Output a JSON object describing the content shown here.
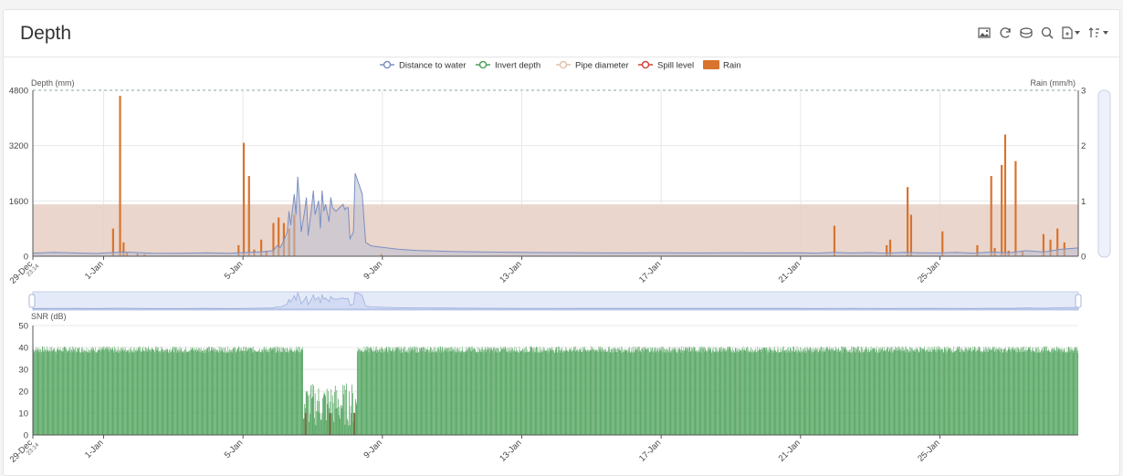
{
  "header": {
    "title": "Depth"
  },
  "toolbar": {
    "icons": [
      "image-icon",
      "refresh-icon",
      "database-icon",
      "search-icon",
      "export-icon",
      "sort-icon"
    ]
  },
  "legend": {
    "items": [
      {
        "label": "Distance to water",
        "color": "#7b8fc3",
        "kind": "line"
      },
      {
        "label": "Invert depth",
        "color": "#4ea05e",
        "kind": "line"
      },
      {
        "label": "Pipe diameter",
        "color": "#e0c2ad",
        "kind": "line"
      },
      {
        "label": "Spill level",
        "color": "#d1453b",
        "kind": "line"
      },
      {
        "label": "Rain",
        "color": "#d8742e",
        "kind": "bar"
      }
    ]
  },
  "colors": {
    "grid": "#e8e8e8",
    "axis": "#555555",
    "snr": "#5aa866",
    "snrDark": "#7a6a3a",
    "band": "#e8d2c6",
    "level": "#7b8fc3"
  },
  "chart_data": [
    {
      "type": "line",
      "ylabel": "Depth (mm)",
      "y2label": "Rain (mm/h)",
      "ylim": [
        0,
        4800
      ],
      "y2lim": [
        0,
        3
      ],
      "yticks": [
        "0",
        "1600",
        "3200",
        "4800"
      ],
      "y2ticks": [
        "0",
        "1",
        "2",
        "3"
      ],
      "xlim": [
        0,
        30
      ],
      "xticks": [
        {
          "label": "29-Dec",
          "sub": "23:14",
          "x": 0
        },
        {
          "label": "1-Jan",
          "x": 2.03
        },
        {
          "label": "5-Jan",
          "x": 6.03
        },
        {
          "label": "9-Jan",
          "x": 10.03
        },
        {
          "label": "13-Jan",
          "x": 14.03
        },
        {
          "label": "17-Jan",
          "x": 18.03
        },
        {
          "label": "21-Jan",
          "x": 22.03
        },
        {
          "label": "25-Jan",
          "x": 26.03
        }
      ],
      "pipe_diameter_band": 1500,
      "series": [
        {
          "name": "Distance to water",
          "points": [
            [
              0,
              90
            ],
            [
              0.6,
              110
            ],
            [
              1.2,
              95
            ],
            [
              1.8,
              80
            ],
            [
              2.6,
              120
            ],
            [
              3.4,
              90
            ],
            [
              4.2,
              85
            ],
            [
              5.0,
              100
            ],
            [
              5.6,
              85
            ],
            [
              6.2,
              110
            ],
            [
              6.6,
              130
            ],
            [
              6.9,
              160
            ],
            [
              7.0,
              300
            ],
            [
              7.1,
              250
            ],
            [
              7.2,
              450
            ],
            [
              7.3,
              700
            ],
            [
              7.35,
              1300
            ],
            [
              7.4,
              900
            ],
            [
              7.5,
              1800
            ],
            [
              7.55,
              1200
            ],
            [
              7.6,
              2300
            ],
            [
              7.65,
              1600
            ],
            [
              7.7,
              700
            ],
            [
              7.8,
              1300
            ],
            [
              7.85,
              1700
            ],
            [
              7.9,
              600
            ],
            [
              8.0,
              1400
            ],
            [
              8.05,
              1900
            ],
            [
              8.1,
              1200
            ],
            [
              8.2,
              1600
            ],
            [
              8.25,
              800
            ],
            [
              8.3,
              1900
            ],
            [
              8.35,
              1300
            ],
            [
              8.4,
              1500
            ],
            [
              8.5,
              1000
            ],
            [
              8.55,
              1700
            ],
            [
              8.6,
              1400
            ],
            [
              8.7,
              1300
            ],
            [
              8.8,
              1400
            ],
            [
              8.9,
              1500
            ],
            [
              8.95,
              1350
            ],
            [
              9.0,
              1400
            ],
            [
              9.05,
              1400
            ],
            [
              9.1,
              500
            ],
            [
              9.2,
              700
            ],
            [
              9.25,
              2400
            ],
            [
              9.35,
              2100
            ],
            [
              9.45,
              1800
            ],
            [
              9.55,
              400
            ],
            [
              9.7,
              300
            ],
            [
              10.0,
              260
            ],
            [
              10.5,
              200
            ],
            [
              11,
              170
            ],
            [
              12,
              140
            ],
            [
              13,
              120
            ],
            [
              14,
              110
            ],
            [
              15,
              105
            ],
            [
              16,
              100
            ],
            [
              17,
              95
            ],
            [
              18,
              100
            ],
            [
              19,
              95
            ],
            [
              20,
              100
            ],
            [
              21,
              95
            ],
            [
              22,
              100
            ],
            [
              22.5,
              90
            ],
            [
              23,
              110
            ],
            [
              23.5,
              95
            ],
            [
              24,
              105
            ],
            [
              24.5,
              90
            ],
            [
              25,
              110
            ],
            [
              25.5,
              100
            ],
            [
              26,
              95
            ],
            [
              26.5,
              110
            ],
            [
              27,
              90
            ],
            [
              27.5,
              120
            ],
            [
              28,
              100
            ],
            [
              28.5,
              160
            ],
            [
              29,
              120
            ],
            [
              29.5,
              200
            ],
            [
              30,
              240
            ]
          ]
        },
        {
          "name": "Rain",
          "bars": [
            [
              2.3,
              0.5
            ],
            [
              2.5,
              2.9
            ],
            [
              2.6,
              0.25
            ],
            [
              2.7,
              0.08
            ],
            [
              3.0,
              0.05
            ],
            [
              3.2,
              0.04
            ],
            [
              5.9,
              0.2
            ],
            [
              6.05,
              2.05
            ],
            [
              6.2,
              1.45
            ],
            [
              6.35,
              0.12
            ],
            [
              6.55,
              0.3
            ],
            [
              6.7,
              0.1
            ],
            [
              6.9,
              0.6
            ],
            [
              7.05,
              0.7
            ],
            [
              7.2,
              0.6
            ],
            [
              7.35,
              0.5
            ],
            [
              7.5,
              0.75
            ],
            [
              10.0,
              0.04
            ],
            [
              23.0,
              0.55
            ],
            [
              24.5,
              0.2
            ],
            [
              24.6,
              0.3
            ],
            [
              25.1,
              1.25
            ],
            [
              25.2,
              0.75
            ],
            [
              26.1,
              0.45
            ],
            [
              27.1,
              0.2
            ],
            [
              27.5,
              1.45
            ],
            [
              27.6,
              0.15
            ],
            [
              27.8,
              1.65
            ],
            [
              27.9,
              2.2
            ],
            [
              28.0,
              0.1
            ],
            [
              28.2,
              1.72
            ],
            [
              28.4,
              0.1
            ],
            [
              29.0,
              0.4
            ],
            [
              29.2,
              0.3
            ],
            [
              29.4,
              0.5
            ],
            [
              29.6,
              0.25
            ]
          ]
        }
      ]
    },
    {
      "type": "bar",
      "ylabel": "SNR (dB)",
      "ylim": [
        0,
        50
      ],
      "yticks": [
        "0",
        "10",
        "20",
        "30",
        "40",
        "50"
      ],
      "xlim": [
        0,
        30
      ],
      "xticks": [
        {
          "label": "29-Dec",
          "sub": "23:14",
          "x": 0
        },
        {
          "label": "1-Jan",
          "x": 2.03
        },
        {
          "label": "5-Jan",
          "x": 6.03
        },
        {
          "label": "9-Jan",
          "x": 10.03
        },
        {
          "label": "13-Jan",
          "x": 14.03
        },
        {
          "label": "17-Jan",
          "x": 18.03
        },
        {
          "label": "21-Jan",
          "x": 22.03
        },
        {
          "label": "25-Jan",
          "x": 26.03
        }
      ],
      "series": [
        {
          "name": "SNR",
          "segments": [
            {
              "from": 0,
              "to": 7.75,
              "mean": 39
            },
            {
              "from": 7.75,
              "to": 9.3,
              "mean": 14
            },
            {
              "from": 9.3,
              "to": 30,
              "mean": 39
            }
          ]
        }
      ]
    }
  ]
}
